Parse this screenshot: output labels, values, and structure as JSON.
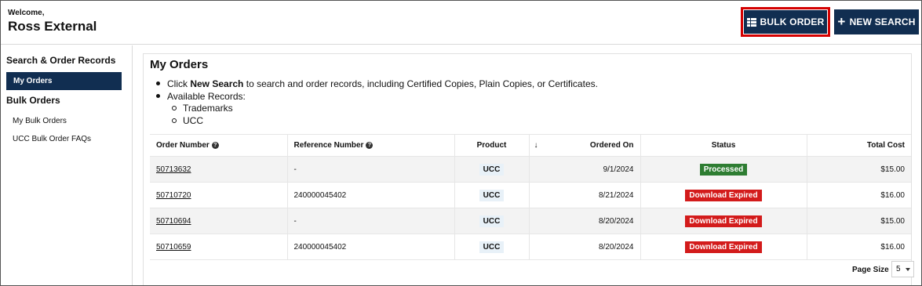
{
  "header": {
    "welcome": "Welcome,",
    "username": "Ross External",
    "bulk_order_label": "BULK ORDER",
    "new_search_label": "NEW SEARCH",
    "highlight_color": "#d40000",
    "brand_color": "#112e51"
  },
  "sidebar": {
    "section1_title": "Search & Order Records",
    "active_item": "My Orders",
    "section2_title": "Bulk Orders",
    "links": [
      "My Bulk Orders",
      "UCC Bulk Order FAQs"
    ]
  },
  "main": {
    "title": "My Orders",
    "bullet1_prefix": "Click",
    "bullet1_bold": "New Search",
    "bullet1_rest": "to search and order records, including Certified Copies, Plain Copies, or Certificates.",
    "bullet2": "Available Records:",
    "sub_bullets": [
      "Trademarks",
      "UCC"
    ]
  },
  "table": {
    "headers": {
      "order_number": "Order Number",
      "reference_number": "Reference Number",
      "product": "Product",
      "sort_icon": "↓",
      "ordered_on": "Ordered On",
      "status": "Status",
      "total_cost": "Total Cost"
    },
    "rows": [
      {
        "order": "50713632",
        "reference": "-",
        "product": "UCC",
        "date": "9/1/2024",
        "status": "Processed",
        "status_color": "#2e7d32",
        "cost": "$15.00"
      },
      {
        "order": "50710720",
        "reference": "240000045402",
        "product": "UCC",
        "date": "8/21/2024",
        "status": "Download Expired",
        "status_color": "#d31b1b",
        "cost": "$16.00"
      },
      {
        "order": "50710694",
        "reference": "-",
        "product": "UCC",
        "date": "8/20/2024",
        "status": "Download Expired",
        "status_color": "#d31b1b",
        "cost": "$15.00"
      },
      {
        "order": "50710659",
        "reference": "240000045402",
        "product": "UCC",
        "date": "8/20/2024",
        "status": "Download Expired",
        "status_color": "#d31b1b",
        "cost": "$16.00"
      }
    ]
  },
  "pagination": {
    "page_size_label": "Page Size",
    "page_size_value": "5"
  }
}
